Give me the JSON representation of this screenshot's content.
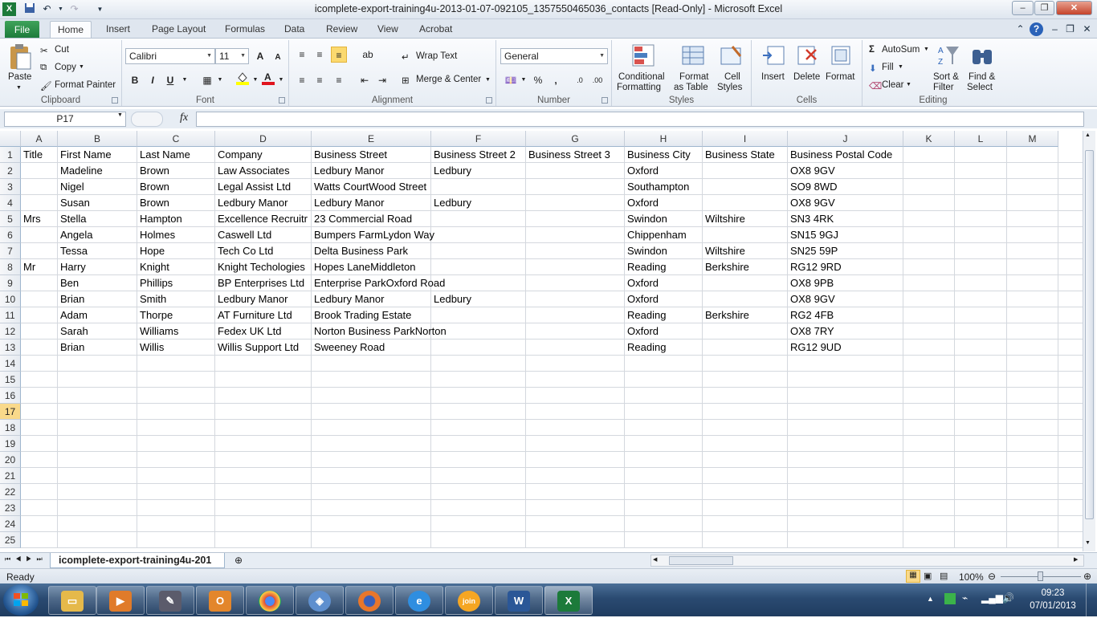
{
  "window": {
    "title": "icomplete-export-training4u-2013-01-07-092105_1357550465036_contacts  [Read-Only]  -  Microsoft Excel"
  },
  "tabs": [
    "File",
    "Home",
    "Insert",
    "Page Layout",
    "Formulas",
    "Data",
    "Review",
    "View",
    "Acrobat"
  ],
  "clipboard": {
    "paste": "Paste",
    "cut": "Cut",
    "copy": "Copy",
    "format_painter": "Format Painter",
    "label": "Clipboard"
  },
  "font": {
    "name": "Calibri",
    "size": "11",
    "label": "Font",
    "bold": "B",
    "italic": "I",
    "underline": "U",
    "grow": "A",
    "shrink": "A"
  },
  "alignment": {
    "wrap": "Wrap Text",
    "merge": "Merge & Center",
    "label": "Alignment"
  },
  "number": {
    "format": "General",
    "label": "Number",
    "percent": "%",
    "comma": ","
  },
  "styles": {
    "conditional": [
      "Conditional",
      "Formatting"
    ],
    "table": [
      "Format",
      "as Table"
    ],
    "cell": [
      "Cell",
      "Styles"
    ],
    "label": "Styles"
  },
  "cells": {
    "insert": "Insert",
    "delete": "Delete",
    "format": "Format",
    "label": "Cells"
  },
  "editing": {
    "autosum": "AutoSum",
    "fill": "Fill",
    "clear": "Clear",
    "sort": [
      "Sort &",
      "Filter"
    ],
    "find": [
      "Find &",
      "Select"
    ],
    "label": "Editing"
  },
  "formula_bar": {
    "name_box": "P17",
    "fx": "fx",
    "value": ""
  },
  "columns": [
    "A",
    "B",
    "C",
    "D",
    "E",
    "F",
    "G",
    "H",
    "I",
    "J",
    "K",
    "L",
    "M"
  ],
  "row_numbers": [
    "1",
    "2",
    "3",
    "4",
    "5",
    "6",
    "7",
    "8",
    "9",
    "10",
    "11",
    "12",
    "13",
    "14",
    "15",
    "16",
    "17",
    "18",
    "19",
    "20",
    "21",
    "22",
    "23",
    "24",
    "25"
  ],
  "rows": [
    [
      "Title",
      "First Name",
      "Last Name",
      "Company",
      "Business Street",
      "Business Street 2",
      "Business Street 3",
      "Business City",
      "Business State",
      "Business Postal Code"
    ],
    [
      "",
      "Madeline",
      "Brown",
      "Law Associates",
      "Ledbury Manor",
      "Ledbury",
      "",
      "Oxford",
      "",
      "OX8 9GV"
    ],
    [
      "",
      "Nigel",
      "Brown",
      "Legal Assist Ltd",
      "Watts CourtWood Street",
      "",
      "",
      "Southampton",
      "",
      "SO9 8WD"
    ],
    [
      "",
      "Susan",
      "Brown",
      "Ledbury Manor",
      "Ledbury Manor",
      "Ledbury",
      "",
      "Oxford",
      "",
      "OX8 9GV"
    ],
    [
      "Mrs",
      "Stella",
      "Hampton",
      "Excellence Recruitr",
      "23 Commercial Road",
      "",
      "",
      "Swindon",
      "Wiltshire",
      "SN3 4RK"
    ],
    [
      "",
      "Angela",
      "Holmes",
      "Caswell Ltd",
      "Bumpers FarmLydon Way",
      "",
      "",
      "Chippenham",
      "",
      "SN15 9GJ"
    ],
    [
      "",
      "Tessa",
      "Hope",
      "Tech Co Ltd",
      "Delta Business Park",
      "",
      "",
      "Swindon",
      "Wiltshire",
      "SN25 59P"
    ],
    [
      "Mr",
      "Harry",
      "Knight",
      "Knight Techologies",
      "Hopes LaneMiddleton",
      "",
      "",
      "Reading",
      "Berkshire",
      "RG12 9RD"
    ],
    [
      "",
      "Ben",
      "Phillips",
      "BP Enterprises Ltd",
      "Enterprise ParkOxford Road",
      "",
      "",
      "Oxford",
      "",
      "OX8 9PB"
    ],
    [
      "",
      "Brian",
      "Smith",
      "Ledbury Manor",
      "Ledbury Manor",
      "Ledbury",
      "",
      "Oxford",
      "",
      "OX8 9GV"
    ],
    [
      "",
      "Adam",
      "Thorpe",
      "AT Furniture Ltd",
      "Brook Trading Estate",
      "",
      "",
      "Reading",
      "Berkshire",
      "RG2 4FB"
    ],
    [
      "",
      "Sarah",
      "Williams",
      "Fedex UK Ltd",
      "Norton Business ParkNorton",
      "",
      "",
      "Oxford",
      "",
      "OX8 7RY"
    ],
    [
      "",
      "Brian",
      "Willis",
      "Willis Support Ltd",
      "Sweeney Road",
      "",
      "",
      "Reading",
      "",
      "RG12 9UD"
    ]
  ],
  "selected_row": "17",
  "sheet_tab": "icomplete-export-training4u-201",
  "status": {
    "ready": "Ready",
    "zoom": "100%"
  },
  "taskbar": {
    "time": "09:23",
    "date": "07/01/2013"
  },
  "colors": {
    "excel_green": "#1c7a3a",
    "selected_header": "#f9d98a",
    "taskbar": "#2a4a71"
  }
}
